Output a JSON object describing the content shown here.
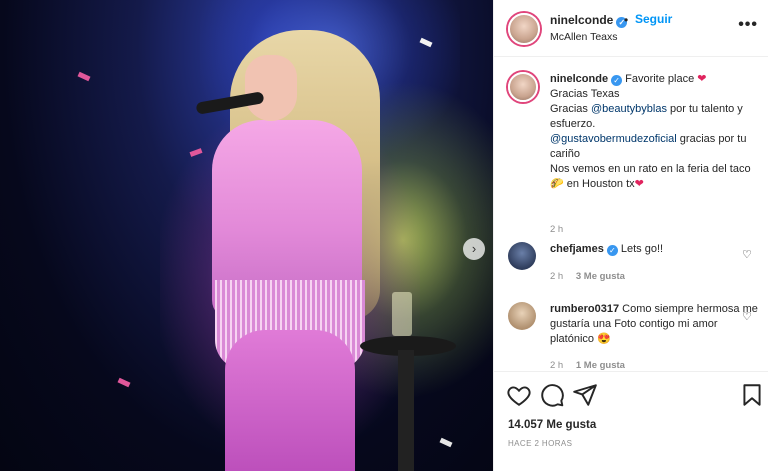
{
  "post": {
    "username": "ninelconde",
    "follow_label": "Seguir",
    "location": "McAllen Teaxs",
    "more_label": "•••",
    "next_label": "›"
  },
  "caption": {
    "username": "ninelconde",
    "line1": "Favorite place",
    "line2": "Gracias Texas",
    "line3_pre": "Gracias",
    "line3_mention": "@beautybyblas",
    "line3_post": "por tu talento y esfuerzo.",
    "line4_mention": "@gustavobermudezoficial",
    "line4_post": "gracias por tu cariño",
    "line5": "Nos vemos en un rato en la feria del taco",
    "line6": "en Houston tx",
    "time": "2 h"
  },
  "comments": [
    {
      "username": "chefjames",
      "text": "Lets go!!",
      "time": "2 h",
      "likes": "3 Me gusta"
    },
    {
      "username": "rumbero0317",
      "text": "Como siempre hermosa me gustaría una Foto contigo mi amor platónico",
      "time": "2 h",
      "likes": "1 Me gusta"
    }
  ],
  "footer": {
    "likes": "14.057 Me gusta",
    "time": "HACE 2 HORAS"
  },
  "icons": {
    "verified": "verified-check-icon",
    "heart": "heart-icon",
    "comment": "comment-icon",
    "share": "paper-plane-icon",
    "save": "bookmark-icon"
  },
  "colors": {
    "accent": "#0095f6",
    "verified": "#3897f0",
    "story_ring": "#e0457b",
    "heart": "#e0245e"
  }
}
